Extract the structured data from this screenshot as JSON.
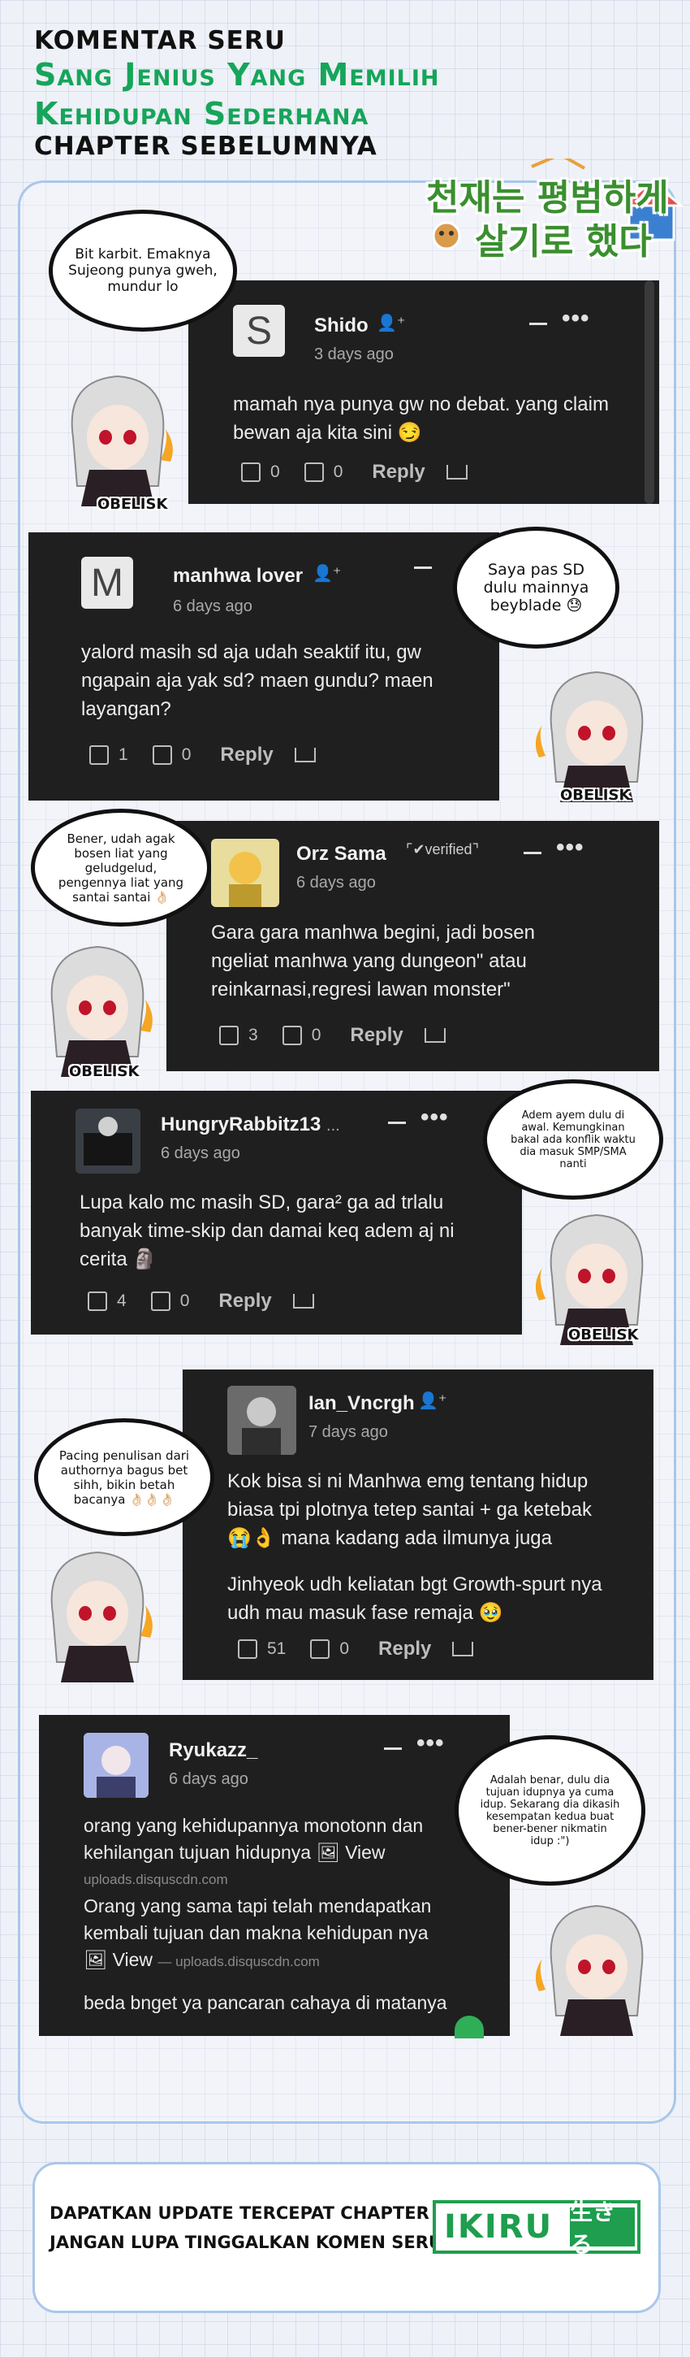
{
  "header": {
    "line1": "KOMENTAR SERU",
    "line2": "Sang Jenius Yang Memilih",
    "line3": "Kehidupan Sederhana",
    "line4": "CHAPTER SEBELUMNYA"
  },
  "logo": {
    "row1": "천재는 평범하게",
    "row2": "살기로 했다"
  },
  "character_tag": "OBELISK",
  "comments": [
    {
      "user": "Shido",
      "date": "3 days ago",
      "text": [
        "mamah nya punya gw no debat. yang claim",
        "bewan aja kita sini 😏"
      ],
      "likes": "0",
      "dislikes": "0",
      "reply": "Reply",
      "avatar_letter": "S",
      "bubble": "Bit karbit. Emaknya Sujeong punya gweh, mundur lo"
    },
    {
      "user": "manhwa lover",
      "date": "6 days ago",
      "text": [
        "yalord masih sd aja udah seaktif itu, gw",
        "ngapain aja yak sd? maen gundu? maen",
        "layangan?"
      ],
      "likes": "1",
      "dislikes": "0",
      "reply": "Reply",
      "avatar_letter": "M",
      "bubble": "Saya pas SD dulu mainnya beyblade 😓"
    },
    {
      "user": "Orz Sama",
      "verified": "verified",
      "date": "6 days ago",
      "text": [
        "Gara gara manhwa begini, jadi bosen",
        "ngeliat manhwa yang dungeon\" atau",
        "reinkarnasi,regresi lawan monster\""
      ],
      "likes": "3",
      "dislikes": "0",
      "reply": "Reply",
      "bubble": "Bener, udah agak bosen liat yang geludgelud, pengennya liat yang santai santai 👌🏻"
    },
    {
      "user": "HungryRabbitz13",
      "user_suffix": "...",
      "date": "6 days ago",
      "text": [
        "Lupa kalo mc masih SD, gara² ga ad trlalu",
        "banyak time-skip dan damai keq adem aj ni",
        "cerita 🗿"
      ],
      "likes": "4",
      "dislikes": "0",
      "reply": "Reply",
      "bubble": "Adem ayem dulu di awal. Kemungkinan bakal ada konflik waktu dia masuk SMP/SMA nanti"
    },
    {
      "user": "Ian_Vncrgh",
      "date": "7 days ago",
      "text": [
        "Kok bisa si ni Manhwa emg tentang hidup",
        "biasa tpi plotnya tetep santai + ga ketebak",
        "😭👌 mana kadang ada ilmunya juga",
        "",
        "Jinhyeok udh keliatan bgt Growth-spurt nya",
        "udh mau masuk fase remaja 🥹"
      ],
      "likes": "51",
      "dislikes": "0",
      "reply": "Reply",
      "bubble": "Pacing penulisan dari authornya bagus bet sihh, bikin betah bacanya 👌🏻👌🏻👌🏻"
    },
    {
      "user": "Ryukazz_",
      "date": "6 days ago",
      "text": [
        "orang yang kehidupannya monotonn dan",
        "kehilangan tujuan hidupnya"
      ],
      "view_label": "View",
      "link": "uploads.disquscdn.com",
      "text2": [
        "Orang yang sama tapi telah mendapatkan",
        "kembali tujuan dan makna kehidupan nya"
      ],
      "view_label2": "View",
      "link2": "— uploads.disquscdn.com",
      "text3": "beda bnget ya pancaran cahaya di matanya",
      "bubble": "Adalah benar, dulu dia tujuan idupnya ya cuma idup. Sekarang dia dikasih kesempatan kedua buat bener-bener nikmatin idup :\")"
    }
  ],
  "footer": {
    "line1": "DAPATKAN UPDATE TERCEPAT CHAPTER BERIKUTNYA DI",
    "line2": "JANGAN LUPA TINGGALKAN KOMEN SERU BIAR DI NOTIS",
    "brand": "IKIRU",
    "brand_jp": "生きる"
  },
  "colors": {
    "accent_green": "#16a55a",
    "card_bg": "#1f1f1f",
    "frame_border": "#a9c7ea"
  }
}
